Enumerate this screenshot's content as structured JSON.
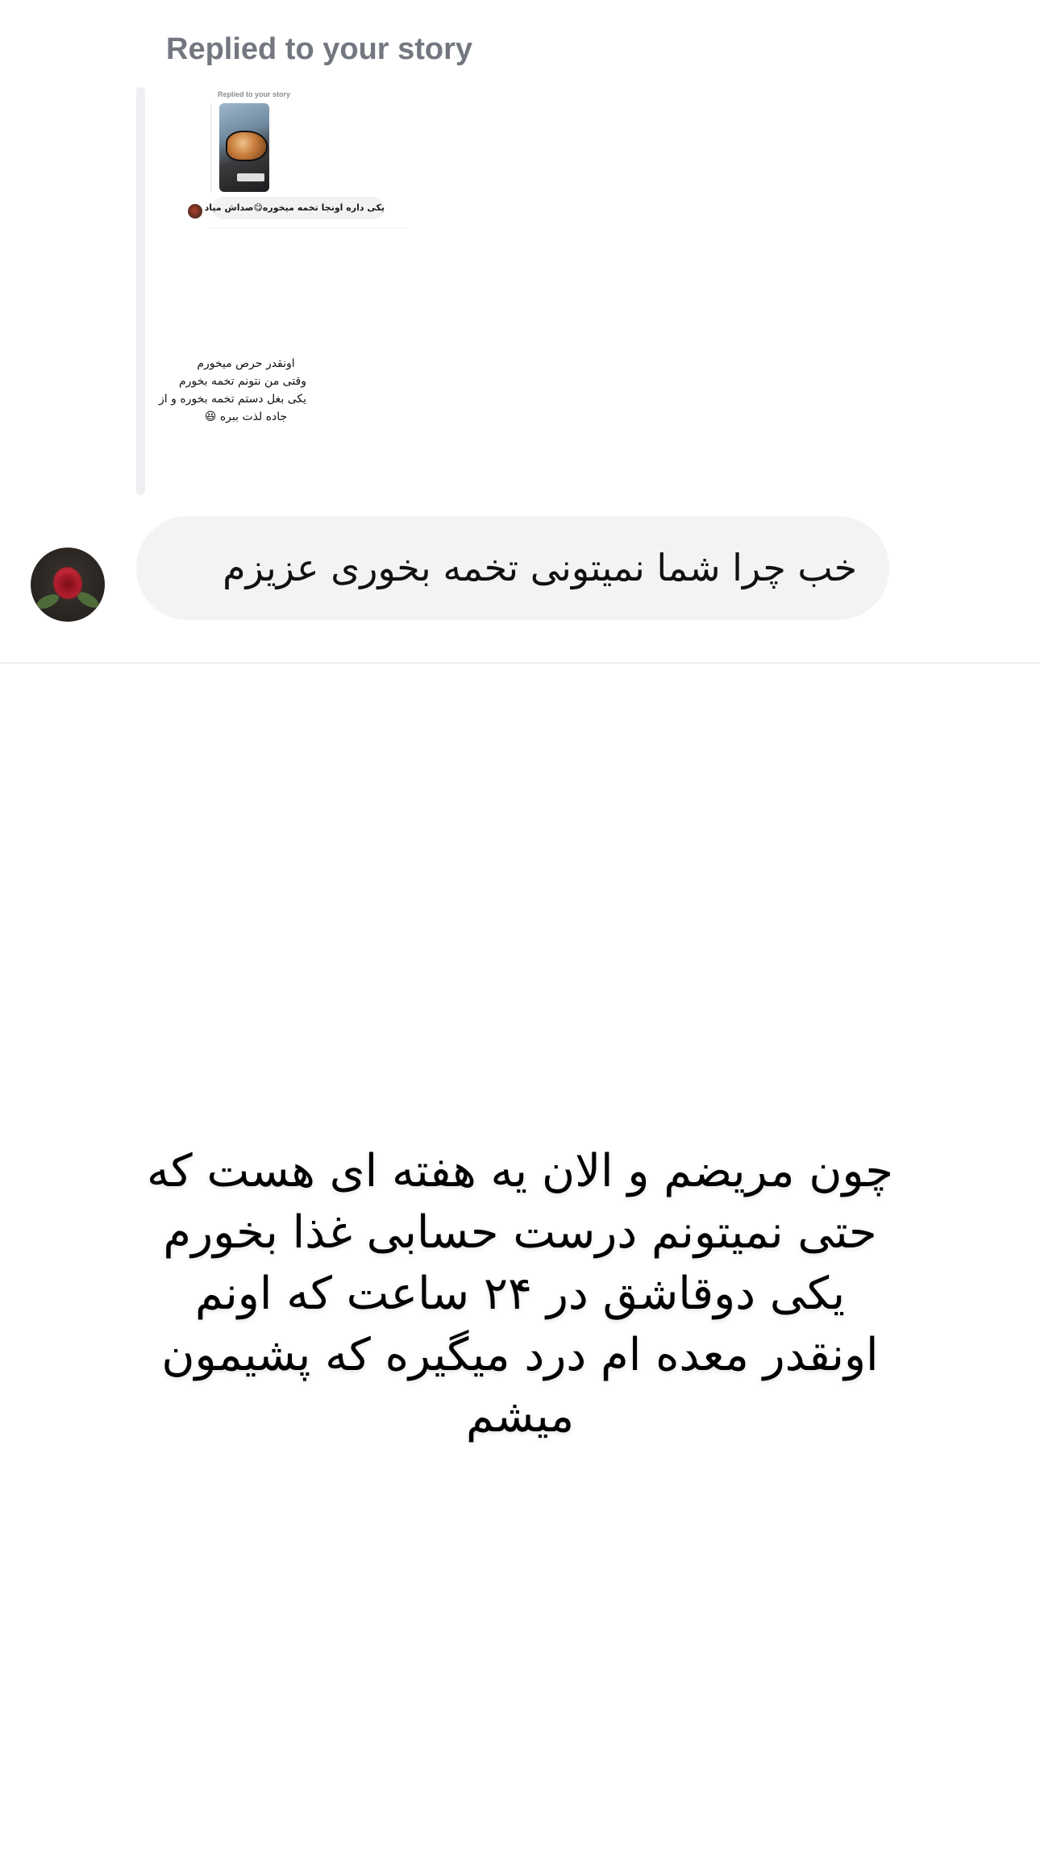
{
  "thread": {
    "replied_label": "Replied to your story"
  },
  "story_preview": {
    "replied_label": "Replied to your story",
    "reply_text": "یکی داره اونجا تخمه میخوره😋صداش میاد",
    "caption_lines": [
      "اونقدر حرص میخورم",
      "وقتی من نتونم تخمه بخورم",
      "یکی بغل دستم تخمه بخوره و از",
      "جاده لذت ببره 😆"
    ]
  },
  "message": {
    "text": "خب چرا شما نمیتونی تخمه بخوری عزیزم"
  },
  "overlay": {
    "lines": [
      "چون مریضم و الان یه هفته ای هست که",
      "حتی نمیتونم درست حسابی غذا بخورم",
      "یکی دوقاشق در ۲۴ ساعت که اونم",
      "اونقدر معده ام درد میگیره که پشیمون",
      "میشم"
    ]
  }
}
